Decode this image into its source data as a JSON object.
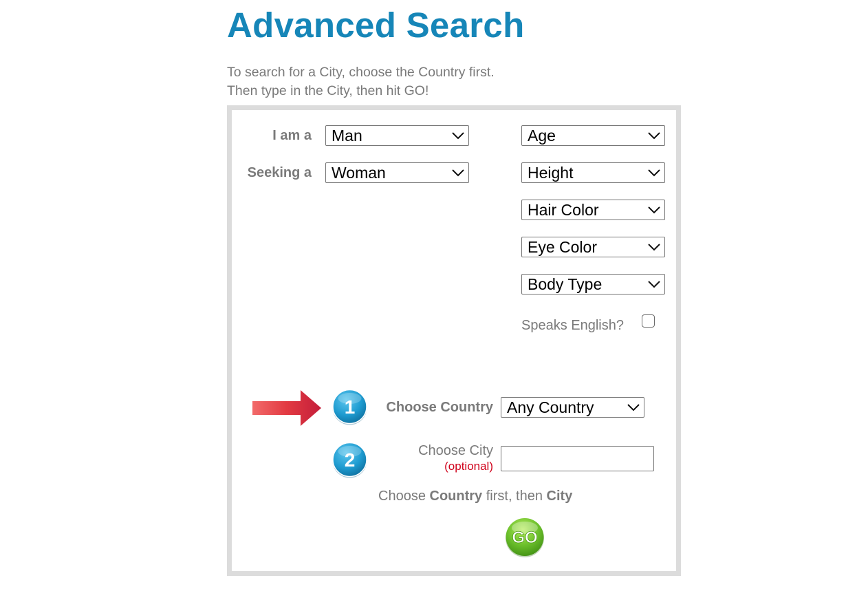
{
  "page": {
    "title": "Advanced Search",
    "instructions": [
      "To search for a City, choose the Country first.",
      "Then type in the City, then hit GO!"
    ]
  },
  "form": {
    "i_am_label": "I am a",
    "i_am_value": "Man",
    "seeking_label": "Seeking a",
    "seeking_value": "Woman",
    "filters": {
      "age": "Age",
      "height": "Height",
      "hair_color": "Hair Color",
      "eye_color": "Eye Color",
      "body_type": "Body Type"
    },
    "speaks_english_label": "Speaks English?",
    "speaks_english_checked": false,
    "step1_number": "1",
    "step2_number": "2",
    "country_label": "Choose Country",
    "country_value": "Any Country",
    "city_label": "Choose City",
    "city_optional": "(optional)",
    "city_value": "",
    "note_prefix": "Choose ",
    "note_country": "Country",
    "note_middle": " first, then ",
    "note_city": "City",
    "go_label": "GO"
  },
  "colors": {
    "title": "#1686b8",
    "text_gray": "#7a7a7a",
    "optional_red": "#d0021b",
    "panel_border": "#dcdcdc",
    "step_badge": "#1e9bd0",
    "go_button": "#6cc02c",
    "arrow": "#e0303a"
  },
  "icons": {
    "select_arrow": "chevron-down-icon",
    "pointer": "arrow-right-icon",
    "step_badge": "numbered-circle-icon",
    "go": "go-button-icon"
  }
}
